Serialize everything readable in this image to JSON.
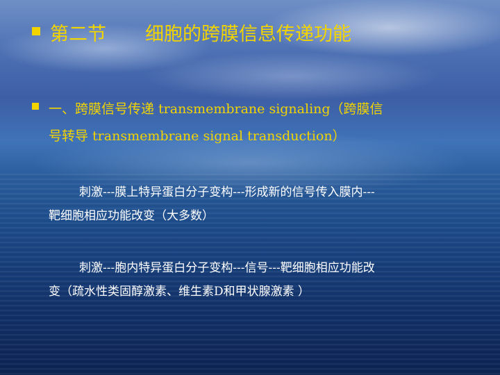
{
  "slide": {
    "title_part1": "第二节",
    "title_part2": "细胞的跨膜信息传递功能",
    "point": {
      "line1": "一、跨膜信号传递 transmembrane signaling（跨膜信",
      "line2": "号转导 transmembrane signal transduction）"
    },
    "paragraphs": [
      {
        "line1": "刺激---膜上特异蛋白分子变构---形成新的信号传入膜内---",
        "line2": "靶细胞相应功能改变（大多数）"
      },
      {
        "line1": "刺激---胞内特异蛋白分子变构---信号---靶细胞相应功能改",
        "line2": "变（疏水性类固醇激素、维生素D和甲状腺激素 ）"
      }
    ]
  },
  "colors": {
    "title": "#f2d400",
    "body_text": "#ffffff",
    "background_top": "#6f8fc6",
    "background_bottom": "#0b2352"
  }
}
